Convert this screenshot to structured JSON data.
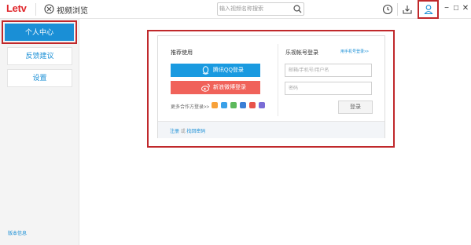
{
  "app": {
    "logo": "Letv",
    "browse_label": "视频浏览"
  },
  "search": {
    "placeholder": "输入视频名称搜索"
  },
  "toolbar": {
    "icons": [
      "history-icon",
      "download-icon",
      "user-icon"
    ],
    "window_controls": [
      "−",
      "□",
      "✕"
    ]
  },
  "sidebar": {
    "items": [
      {
        "label": "个人中心",
        "active": true
      },
      {
        "label": "反馈建议",
        "active": false
      },
      {
        "label": "设置",
        "active": false
      }
    ],
    "version_link": "版本信息"
  },
  "login": {
    "recommend_title": "推荐使用",
    "qq_button": "腾讯QQ登录",
    "weibo_button": "新浪微博登录",
    "partners_label": "更多合作方登录>>",
    "account_title": "乐视帐号登录",
    "phone_link": "用手机号登录>>",
    "account_placeholder": "邮箱/手机号/用户名",
    "password_placeholder": "密码",
    "login_button": "登录",
    "register_link": "注册",
    "or_text": "或",
    "forgot_link": "找回密码"
  },
  "colors": {
    "accent": "#1a8fd6",
    "qq_button": "#1a9ae0",
    "weibo_button": "#f0625a",
    "highlight_border": "#c0282b"
  }
}
